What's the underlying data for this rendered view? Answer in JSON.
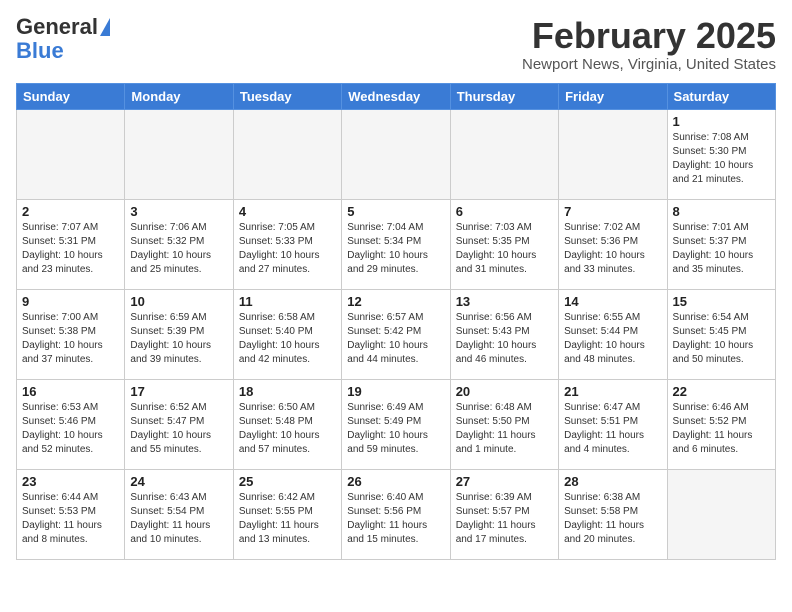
{
  "header": {
    "logo_general": "General",
    "logo_blue": "Blue",
    "month_title": "February 2025",
    "location": "Newport News, Virginia, United States"
  },
  "weekdays": [
    "Sunday",
    "Monday",
    "Tuesday",
    "Wednesday",
    "Thursday",
    "Friday",
    "Saturday"
  ],
  "weeks": [
    [
      {
        "day": "",
        "info": ""
      },
      {
        "day": "",
        "info": ""
      },
      {
        "day": "",
        "info": ""
      },
      {
        "day": "",
        "info": ""
      },
      {
        "day": "",
        "info": ""
      },
      {
        "day": "",
        "info": ""
      },
      {
        "day": "1",
        "info": "Sunrise: 7:08 AM\nSunset: 5:30 PM\nDaylight: 10 hours and 21 minutes."
      }
    ],
    [
      {
        "day": "2",
        "info": "Sunrise: 7:07 AM\nSunset: 5:31 PM\nDaylight: 10 hours and 23 minutes."
      },
      {
        "day": "3",
        "info": "Sunrise: 7:06 AM\nSunset: 5:32 PM\nDaylight: 10 hours and 25 minutes."
      },
      {
        "day": "4",
        "info": "Sunrise: 7:05 AM\nSunset: 5:33 PM\nDaylight: 10 hours and 27 minutes."
      },
      {
        "day": "5",
        "info": "Sunrise: 7:04 AM\nSunset: 5:34 PM\nDaylight: 10 hours and 29 minutes."
      },
      {
        "day": "6",
        "info": "Sunrise: 7:03 AM\nSunset: 5:35 PM\nDaylight: 10 hours and 31 minutes."
      },
      {
        "day": "7",
        "info": "Sunrise: 7:02 AM\nSunset: 5:36 PM\nDaylight: 10 hours and 33 minutes."
      },
      {
        "day": "8",
        "info": "Sunrise: 7:01 AM\nSunset: 5:37 PM\nDaylight: 10 hours and 35 minutes."
      }
    ],
    [
      {
        "day": "9",
        "info": "Sunrise: 7:00 AM\nSunset: 5:38 PM\nDaylight: 10 hours and 37 minutes."
      },
      {
        "day": "10",
        "info": "Sunrise: 6:59 AM\nSunset: 5:39 PM\nDaylight: 10 hours and 39 minutes."
      },
      {
        "day": "11",
        "info": "Sunrise: 6:58 AM\nSunset: 5:40 PM\nDaylight: 10 hours and 42 minutes."
      },
      {
        "day": "12",
        "info": "Sunrise: 6:57 AM\nSunset: 5:42 PM\nDaylight: 10 hours and 44 minutes."
      },
      {
        "day": "13",
        "info": "Sunrise: 6:56 AM\nSunset: 5:43 PM\nDaylight: 10 hours and 46 minutes."
      },
      {
        "day": "14",
        "info": "Sunrise: 6:55 AM\nSunset: 5:44 PM\nDaylight: 10 hours and 48 minutes."
      },
      {
        "day": "15",
        "info": "Sunrise: 6:54 AM\nSunset: 5:45 PM\nDaylight: 10 hours and 50 minutes."
      }
    ],
    [
      {
        "day": "16",
        "info": "Sunrise: 6:53 AM\nSunset: 5:46 PM\nDaylight: 10 hours and 52 minutes."
      },
      {
        "day": "17",
        "info": "Sunrise: 6:52 AM\nSunset: 5:47 PM\nDaylight: 10 hours and 55 minutes."
      },
      {
        "day": "18",
        "info": "Sunrise: 6:50 AM\nSunset: 5:48 PM\nDaylight: 10 hours and 57 minutes."
      },
      {
        "day": "19",
        "info": "Sunrise: 6:49 AM\nSunset: 5:49 PM\nDaylight: 10 hours and 59 minutes."
      },
      {
        "day": "20",
        "info": "Sunrise: 6:48 AM\nSunset: 5:50 PM\nDaylight: 11 hours and 1 minute."
      },
      {
        "day": "21",
        "info": "Sunrise: 6:47 AM\nSunset: 5:51 PM\nDaylight: 11 hours and 4 minutes."
      },
      {
        "day": "22",
        "info": "Sunrise: 6:46 AM\nSunset: 5:52 PM\nDaylight: 11 hours and 6 minutes."
      }
    ],
    [
      {
        "day": "23",
        "info": "Sunrise: 6:44 AM\nSunset: 5:53 PM\nDaylight: 11 hours and 8 minutes."
      },
      {
        "day": "24",
        "info": "Sunrise: 6:43 AM\nSunset: 5:54 PM\nDaylight: 11 hours and 10 minutes."
      },
      {
        "day": "25",
        "info": "Sunrise: 6:42 AM\nSunset: 5:55 PM\nDaylight: 11 hours and 13 minutes."
      },
      {
        "day": "26",
        "info": "Sunrise: 6:40 AM\nSunset: 5:56 PM\nDaylight: 11 hours and 15 minutes."
      },
      {
        "day": "27",
        "info": "Sunrise: 6:39 AM\nSunset: 5:57 PM\nDaylight: 11 hours and 17 minutes."
      },
      {
        "day": "28",
        "info": "Sunrise: 6:38 AM\nSunset: 5:58 PM\nDaylight: 11 hours and 20 minutes."
      },
      {
        "day": "",
        "info": ""
      }
    ]
  ]
}
